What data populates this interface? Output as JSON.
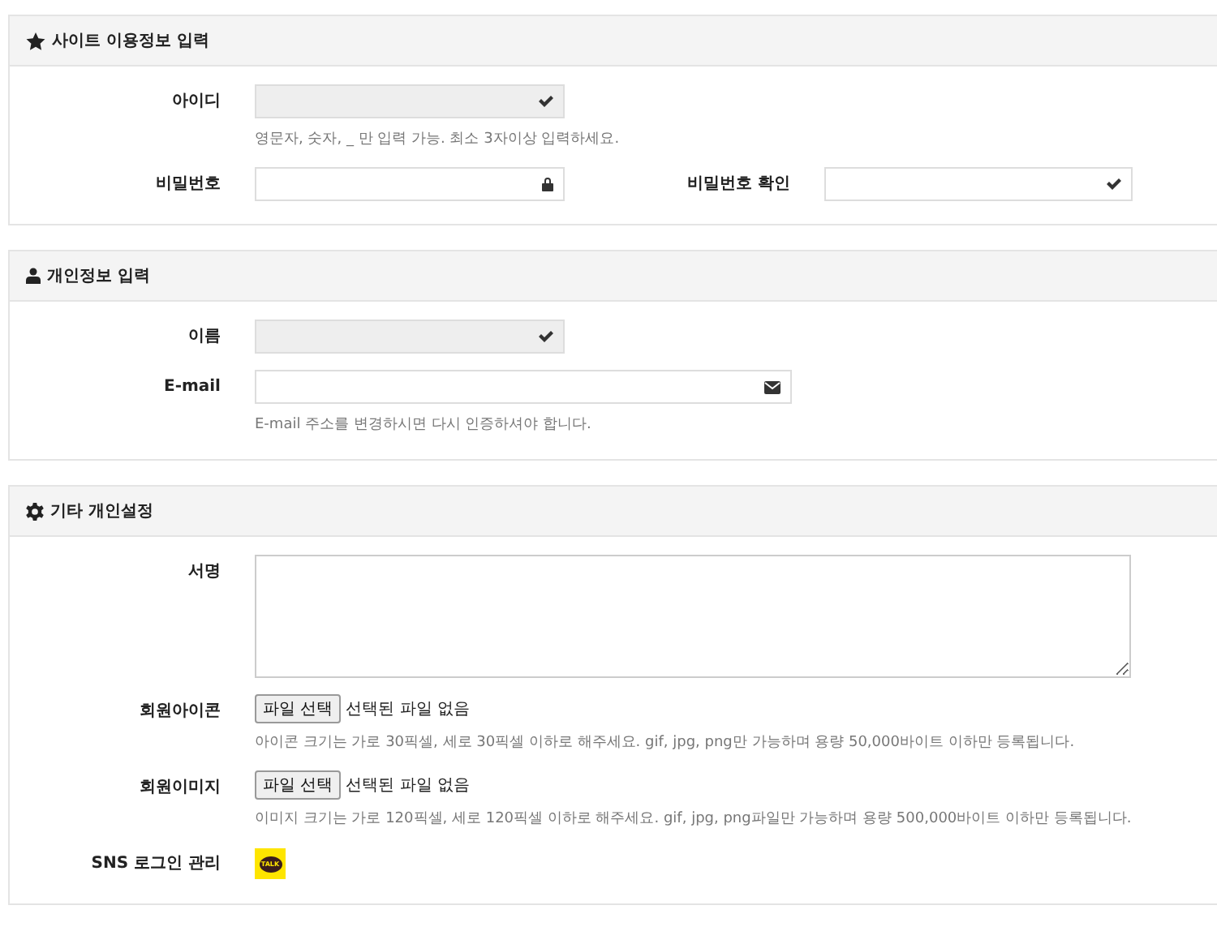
{
  "sections": [
    {
      "title": "사이트 이용정보 입력",
      "rows": [
        {
          "kind": "text",
          "label": "아이디",
          "disabled": true,
          "help": "영문자, 숫자, _ 만 입력 가능. 최소 3자이상 입력하세요."
        },
        {
          "kind": "password-pair",
          "fields": [
            {
              "label": "비밀번호",
              "disabled": false
            },
            {
              "label": "비밀번호 확인",
              "disabled": false
            }
          ]
        }
      ]
    },
    {
      "title": "개인정보 입력",
      "rows": [
        {
          "kind": "text",
          "label": "이름",
          "disabled": true
        },
        {
          "kind": "email",
          "label": "E-mail",
          "disabled": false,
          "help": "E-mail 주소를 변경하시면 다시 인증하셔야 합니다."
        }
      ]
    },
    {
      "title": "기타 개인설정",
      "rows": [
        {
          "kind": "textarea",
          "label": "서명"
        },
        {
          "kind": "file",
          "label": "회원아이콘",
          "button": "파일 선택",
          "status": "선택된 파일 없음",
          "help": "아이콘 크기는 가로 30픽셀, 세로 30픽셀 이하로 해주세요. gif, jpg, png만 가능하며 용량 50,000바이트 이하만 등록됩니다."
        },
        {
          "kind": "file",
          "label": "회원이미지",
          "button": "파일 선택",
          "status": "선택된 파일 없음",
          "help": "이미지 크기는 가로 120픽셀, 세로 120픽셀 이하로 해주세요. gif, jpg, png파일만 가능하며 용량 500,000바이트 이하만 등록됩니다."
        },
        {
          "kind": "sns",
          "label": "SNS 로그인 관리",
          "badge": "TALK"
        }
      ]
    }
  ]
}
